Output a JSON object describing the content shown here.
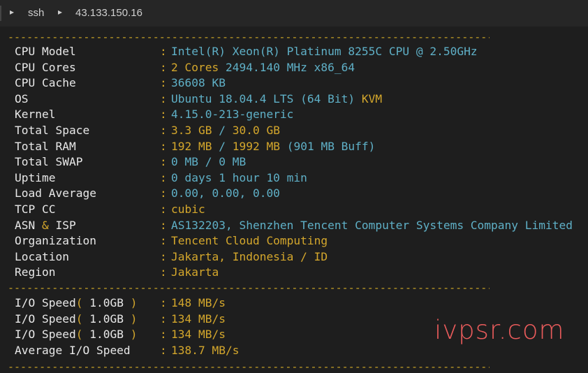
{
  "breadcrumb": {
    "items": [
      "ssh",
      "43.133.150.16"
    ]
  },
  "terminal": {
    "divider": "--------------------------------------------------------------------------------------------------------------------",
    "system_info": [
      {
        "label": "CPU Model",
        "parts": [
          {
            "t": "Intel(R) Xeon(R) Platinum 8255C CPU @ 2.50GHz",
            "c": "c"
          }
        ]
      },
      {
        "label": "CPU Cores",
        "parts": [
          {
            "t": "2 Cores",
            "c": "y"
          },
          {
            "t": " 2494.140 MHz x86_64",
            "c": "c"
          }
        ]
      },
      {
        "label": "CPU Cache",
        "parts": [
          {
            "t": "36608 KB",
            "c": "c"
          }
        ]
      },
      {
        "label": "OS",
        "parts": [
          {
            "t": "Ubuntu 18.04.4 LTS (64 Bit)",
            "c": "c"
          },
          {
            "t": " KVM",
            "c": "y"
          }
        ]
      },
      {
        "label": "Kernel",
        "parts": [
          {
            "t": "4.15.0-213-generic",
            "c": "c"
          }
        ]
      },
      {
        "label": "Total Space",
        "parts": [
          {
            "t": "3.3 GB",
            "c": "y"
          },
          {
            "t": " / ",
            "c": "c"
          },
          {
            "t": "30.0 GB",
            "c": "y"
          }
        ]
      },
      {
        "label": "Total RAM",
        "parts": [
          {
            "t": "192 MB",
            "c": "y"
          },
          {
            "t": " / ",
            "c": "c"
          },
          {
            "t": "1992 MB",
            "c": "y"
          },
          {
            "t": " (901 MB Buff)",
            "c": "c"
          }
        ]
      },
      {
        "label": "Total SWAP",
        "parts": [
          {
            "t": "0 MB / 0 MB",
            "c": "c"
          }
        ]
      },
      {
        "label": "Uptime",
        "parts": [
          {
            "t": "0 days 1 hour 10 min",
            "c": "c"
          }
        ]
      },
      {
        "label": "Load Average",
        "parts": [
          {
            "t": "0.00, 0.00, 0.00",
            "c": "c"
          }
        ]
      },
      {
        "label": "TCP CC",
        "parts": [
          {
            "t": "cubic",
            "c": "y"
          }
        ]
      },
      {
        "label_parts": [
          {
            "t": "ASN ",
            "c": "w"
          },
          {
            "t": "&",
            "c": "y"
          },
          {
            "t": " ISP",
            "c": "w"
          }
        ],
        "parts": [
          {
            "t": "AS132203, Shenzhen Tencent Computer Systems Company Limited",
            "c": "c"
          }
        ]
      },
      {
        "label": "Organization",
        "parts": [
          {
            "t": "Tencent Cloud Computing",
            "c": "y"
          }
        ]
      },
      {
        "label": "Location",
        "parts": [
          {
            "t": "Jakarta, Indonesia / ID",
            "c": "y"
          }
        ]
      },
      {
        "label": "Region",
        "parts": [
          {
            "t": "Jakarta",
            "c": "y"
          }
        ]
      }
    ],
    "io_speed": [
      {
        "label_parts": [
          {
            "t": "I/O Speed",
            "c": "w"
          },
          {
            "t": "(",
            "c": "y"
          },
          {
            "t": " 1.0GB ",
            "c": "w"
          },
          {
            "t": ")",
            "c": "y"
          }
        ],
        "parts": [
          {
            "t": "148 MB/s",
            "c": "y"
          }
        ]
      },
      {
        "label_parts": [
          {
            "t": "I/O Speed",
            "c": "w"
          },
          {
            "t": "(",
            "c": "y"
          },
          {
            "t": " 1.0GB ",
            "c": "w"
          },
          {
            "t": ")",
            "c": "y"
          }
        ],
        "parts": [
          {
            "t": "134 MB/s",
            "c": "y"
          }
        ]
      },
      {
        "label_parts": [
          {
            "t": "I/O Speed",
            "c": "w"
          },
          {
            "t": "(",
            "c": "y"
          },
          {
            "t": " 1.0GB ",
            "c": "w"
          },
          {
            "t": ")",
            "c": "y"
          }
        ],
        "parts": [
          {
            "t": "134 MB/s",
            "c": "y"
          }
        ]
      },
      {
        "label": "Average I/O Speed",
        "parts": [
          {
            "t": "138.7 MB/s",
            "c": "y"
          }
        ]
      }
    ],
    "colon": ":"
  },
  "watermark": "ivpsr.com",
  "colors": {
    "cyan": "#5fb0c7",
    "yellow": "#d4a72c",
    "label": "#e8e8e8",
    "watermark": "#ff6262"
  }
}
